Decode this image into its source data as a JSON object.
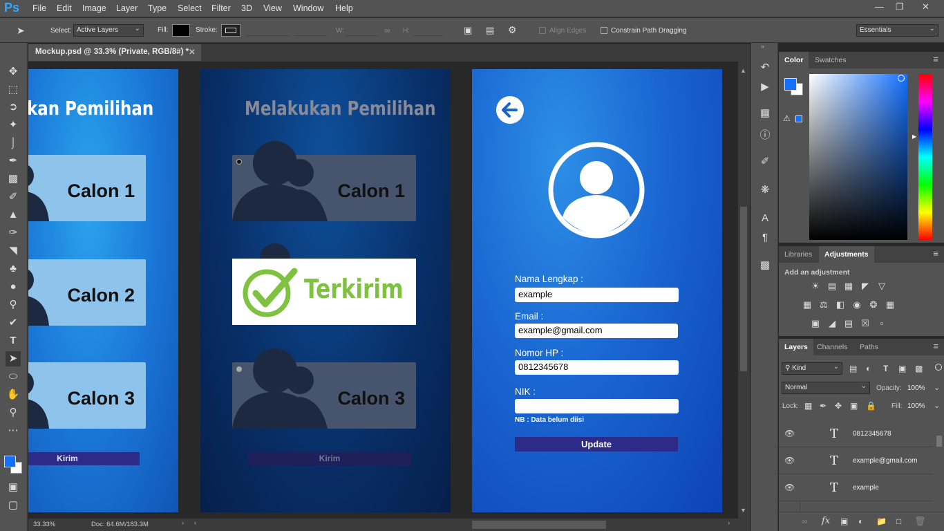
{
  "app": {
    "logo": "Ps",
    "menu": [
      "File",
      "Edit",
      "Image",
      "Layer",
      "Type",
      "Select",
      "Filter",
      "3D",
      "View",
      "Window",
      "Help"
    ]
  },
  "options": {
    "select_label": "Select:",
    "select_value": "Active Layers",
    "fill_label": "Fill:",
    "stroke_label": "Stroke:",
    "w_label": "W:",
    "link_glyph": "∞",
    "h_label": "H:",
    "align_edges": "Align Edges",
    "constrain": "Constrain Path Dragging",
    "workspace": "Essentials"
  },
  "document": {
    "tab_title": "Mockup.psd @ 33.3% (Private, RGB/8#) *",
    "zoom": "33.33%",
    "doc_info": "Doc: 64.6M/183.3M"
  },
  "screen1": {
    "title": "kan Pemilihan",
    "cards": [
      "Calon 1",
      "Calon 2",
      "Calon 3"
    ],
    "button": "Kirim"
  },
  "screen2": {
    "title": "Melakukan Pemilihan",
    "cards": [
      "Calon 1",
      "Calon 3"
    ],
    "popup": "Terkirim",
    "button": "Kirim"
  },
  "screen3": {
    "fields": [
      {
        "label": "Nama Lengkap :",
        "value": "example"
      },
      {
        "label": "Email :",
        "value": "example@gmail.com"
      },
      {
        "label": "Nomor HP :",
        "value": "0812345678"
      },
      {
        "label": "NIK :",
        "value": ""
      }
    ],
    "note": "NB : Data belum diisi",
    "button": "Update"
  },
  "panels": {
    "color": {
      "tabs": [
        "Color",
        "Swatches"
      ],
      "foreground": "#1470ff",
      "background": "#ffffff"
    },
    "adjust": {
      "tabs": [
        "Libraries",
        "Adjustments"
      ],
      "hint": "Add an adjustment"
    },
    "layers": {
      "tabs": [
        "Layers",
        "Channels",
        "Paths"
      ],
      "kind": "Kind",
      "blend": "Normal",
      "opacity_label": "Opacity:",
      "opacity": "100%",
      "lock_label": "Lock:",
      "fill_label": "Fill:",
      "fill": "100%",
      "items": [
        "0812345678",
        "example@gmail.com",
        "example"
      ]
    }
  },
  "colors": {
    "accent": "#31a8ff",
    "check_green": "#7fc241"
  }
}
